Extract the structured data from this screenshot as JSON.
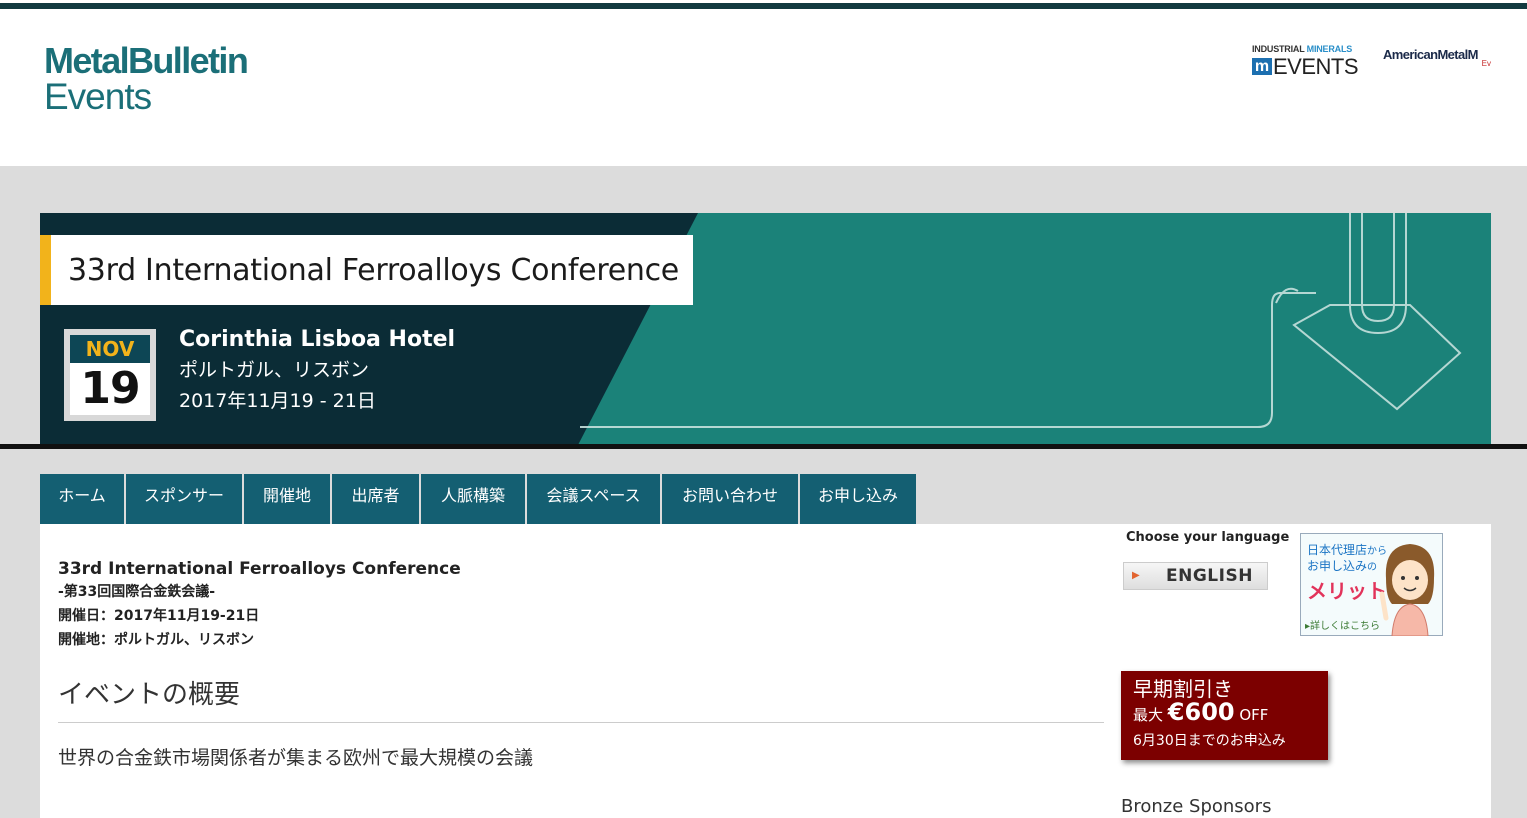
{
  "header": {
    "logo_line1": "MetalBulletin",
    "logo_line2": "Events",
    "partner_im_small": "INDUSTRIAL",
    "partner_im_small_accent": "MINERALS",
    "partner_im_mark": "m",
    "partner_im_events": "EVENTS",
    "partner_am_text": "AmericanMetalM",
    "partner_am_sub": "Ev"
  },
  "banner": {
    "title": "33rd International Ferroalloys Conference",
    "month": "NOV",
    "day": "19",
    "venue": "Corinthia Lisboa Hotel",
    "location": "ポルトガル、リスボン",
    "dates": "2017年11月19 - 21日"
  },
  "nav": {
    "items": [
      {
        "label": "ホーム"
      },
      {
        "label": "スポンサー"
      },
      {
        "label": "開催地"
      },
      {
        "label": "出席者"
      },
      {
        "label": "人脈構築"
      },
      {
        "label": "会議スペース"
      },
      {
        "label": "お問い合わせ"
      },
      {
        "label": "お申し込み"
      }
    ]
  },
  "main": {
    "heading": "33rd International Ferroalloys Conference",
    "subtitle": "-第33回国際合金鉄会議-",
    "date_line": "開催日：2017年11月19-21日",
    "venue_line": "開催地：ポルトガル、リスボン",
    "section_title": "イベントの概要",
    "lead": "世界の合金鉄市場関係者が集まる欧州で最大規模の会議"
  },
  "sidebar": {
    "language_label": "Choose your language",
    "language_button": "ENGLISH",
    "agent_line1": "日本代理店",
    "agent_line1_small": "から",
    "agent_line2": "お申し込み",
    "agent_line2_small": "の",
    "agent_line3": "メリット",
    "agent_link": "詳しくはこちら",
    "promo_title": "早期割引き",
    "promo_prefix": "最大",
    "promo_amount": "€600",
    "promo_suffix": "OFF",
    "promo_deadline": "6月30日までのお申込み",
    "bronze_title": "Bronze Sponsors"
  },
  "colors": {
    "brand_teal": "#1b6f78",
    "banner_dark": "#0b2c36",
    "banner_teal": "#1b8279",
    "accent_yellow": "#f2b31b",
    "nav_bg": "#145f72",
    "promo_red": "#7c0000"
  }
}
